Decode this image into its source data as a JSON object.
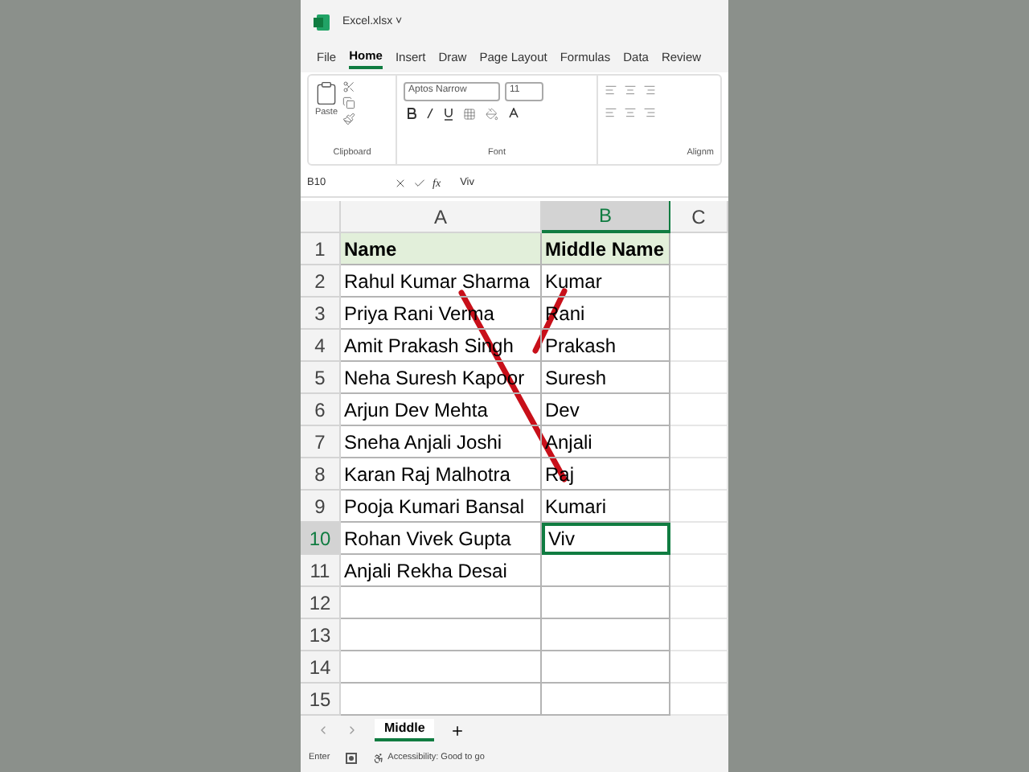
{
  "window": {
    "title": "Excel.xlsx ˅"
  },
  "tabs": [
    {
      "label": "File",
      "selected": false
    },
    {
      "label": "Home",
      "selected": true
    },
    {
      "label": "Insert",
      "selected": false
    },
    {
      "label": "Draw",
      "selected": false
    },
    {
      "label": "Page Layout",
      "selected": false
    },
    {
      "label": "Formulas",
      "selected": false
    },
    {
      "label": "Data",
      "selected": false
    },
    {
      "label": "Review",
      "selected": false
    }
  ],
  "ribbon": {
    "paste_label": "Paste",
    "font_name": "Aptos Narrow",
    "font_size": "11",
    "groups": [
      "Clipboard",
      "Font",
      "Alignm"
    ]
  },
  "formula_bar": {
    "name_box": "B10",
    "fx": "fx",
    "value": "Viv"
  },
  "columns": [
    {
      "label": "A",
      "selected": false
    },
    {
      "label": "B",
      "selected": true
    },
    {
      "label": "C",
      "selected": false
    }
  ],
  "rows": [
    {
      "number": "1",
      "kind": "header",
      "selected": false,
      "cells": [
        "Name",
        "Middle Name"
      ]
    },
    {
      "number": "2",
      "kind": "data",
      "selected": false,
      "cells": [
        "Rahul Kumar Sharma",
        "Kumar"
      ]
    },
    {
      "number": "3",
      "kind": "data",
      "selected": false,
      "cells": [
        "Priya Rani Verma",
        "Rani"
      ]
    },
    {
      "number": "4",
      "kind": "data",
      "selected": false,
      "cells": [
        "Amit Prakash Singh",
        "Prakash"
      ]
    },
    {
      "number": "5",
      "kind": "data",
      "selected": false,
      "cells": [
        "Neha Suresh Kapoor",
        "Suresh"
      ]
    },
    {
      "number": "6",
      "kind": "data",
      "selected": false,
      "cells": [
        "Arjun Dev Mehta",
        "Dev"
      ]
    },
    {
      "number": "7",
      "kind": "data",
      "selected": false,
      "cells": [
        "Sneha Anjali Joshi",
        "Anjali"
      ]
    },
    {
      "number": "8",
      "kind": "data",
      "selected": false,
      "cells": [
        "Karan Raj Malhotra",
        "Raj"
      ]
    },
    {
      "number": "9",
      "kind": "data",
      "selected": false,
      "cells": [
        "Pooja Kumari Bansal",
        "Kumari"
      ]
    },
    {
      "number": "10",
      "kind": "data",
      "selected": true,
      "cells": [
        "Rohan Vivek Gupta",
        "Viv"
      ]
    },
    {
      "number": "11",
      "kind": "data",
      "selected": false,
      "cells": [
        "Anjali Rekha Desai"
      ]
    },
    {
      "number": "12",
      "kind": "data",
      "selected": false
    },
    {
      "number": "13",
      "kind": "data",
      "selected": false
    },
    {
      "number": "14",
      "kind": "data",
      "selected": false
    },
    {
      "number": "15",
      "kind": "data",
      "selected": false
    }
  ],
  "sheet_tabs": [
    {
      "label": "Middle",
      "selected": true
    }
  ],
  "status_bar": {
    "mode": "Enter",
    "accessibility": "Accessibility: Good to go"
  }
}
